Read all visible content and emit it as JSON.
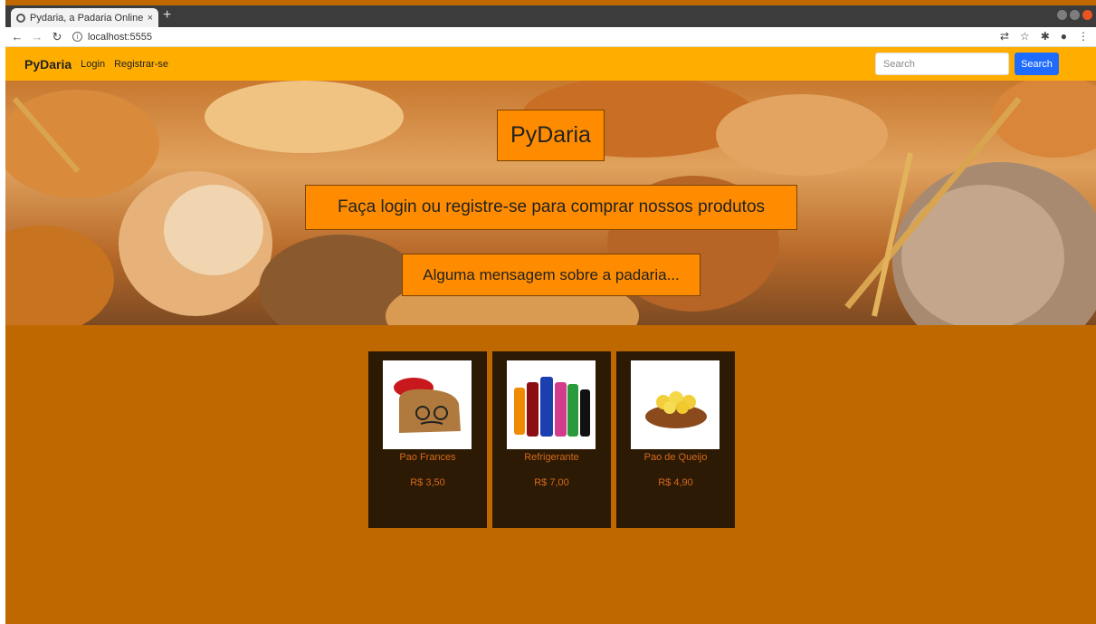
{
  "browser": {
    "tab_title": "Pydaria, a Padaria Online",
    "tab_close": "×",
    "new_tab": "+",
    "url": "localhost:5555"
  },
  "navbar": {
    "brand": "PyDaria",
    "login": "Login",
    "register": "Registrar-se",
    "search_placeholder": "Search",
    "search_button": "Search"
  },
  "hero": {
    "title": "PyDaria",
    "subtitle": "Faça login ou registre-se para comprar nossos produtos",
    "message": "Alguma mensagem sobre a padaria..."
  },
  "products": [
    {
      "name": "Pao Frances",
      "price": "R$ 3,50",
      "icon": "bread-character-icon"
    },
    {
      "name": "Refrigerante",
      "price": "R$ 7,00",
      "icon": "soda-bottles-icon"
    },
    {
      "name": "Pao de Queijo",
      "price": "R$ 4,90",
      "icon": "cheese-bread-basket-icon"
    }
  ],
  "colors": {
    "navbar": "#ffae00",
    "page_background": "#c06800",
    "hero_box": "#ff8c00",
    "card": "#2c1a04",
    "card_text": "#d66a1c",
    "search_button": "#1f6bff"
  }
}
